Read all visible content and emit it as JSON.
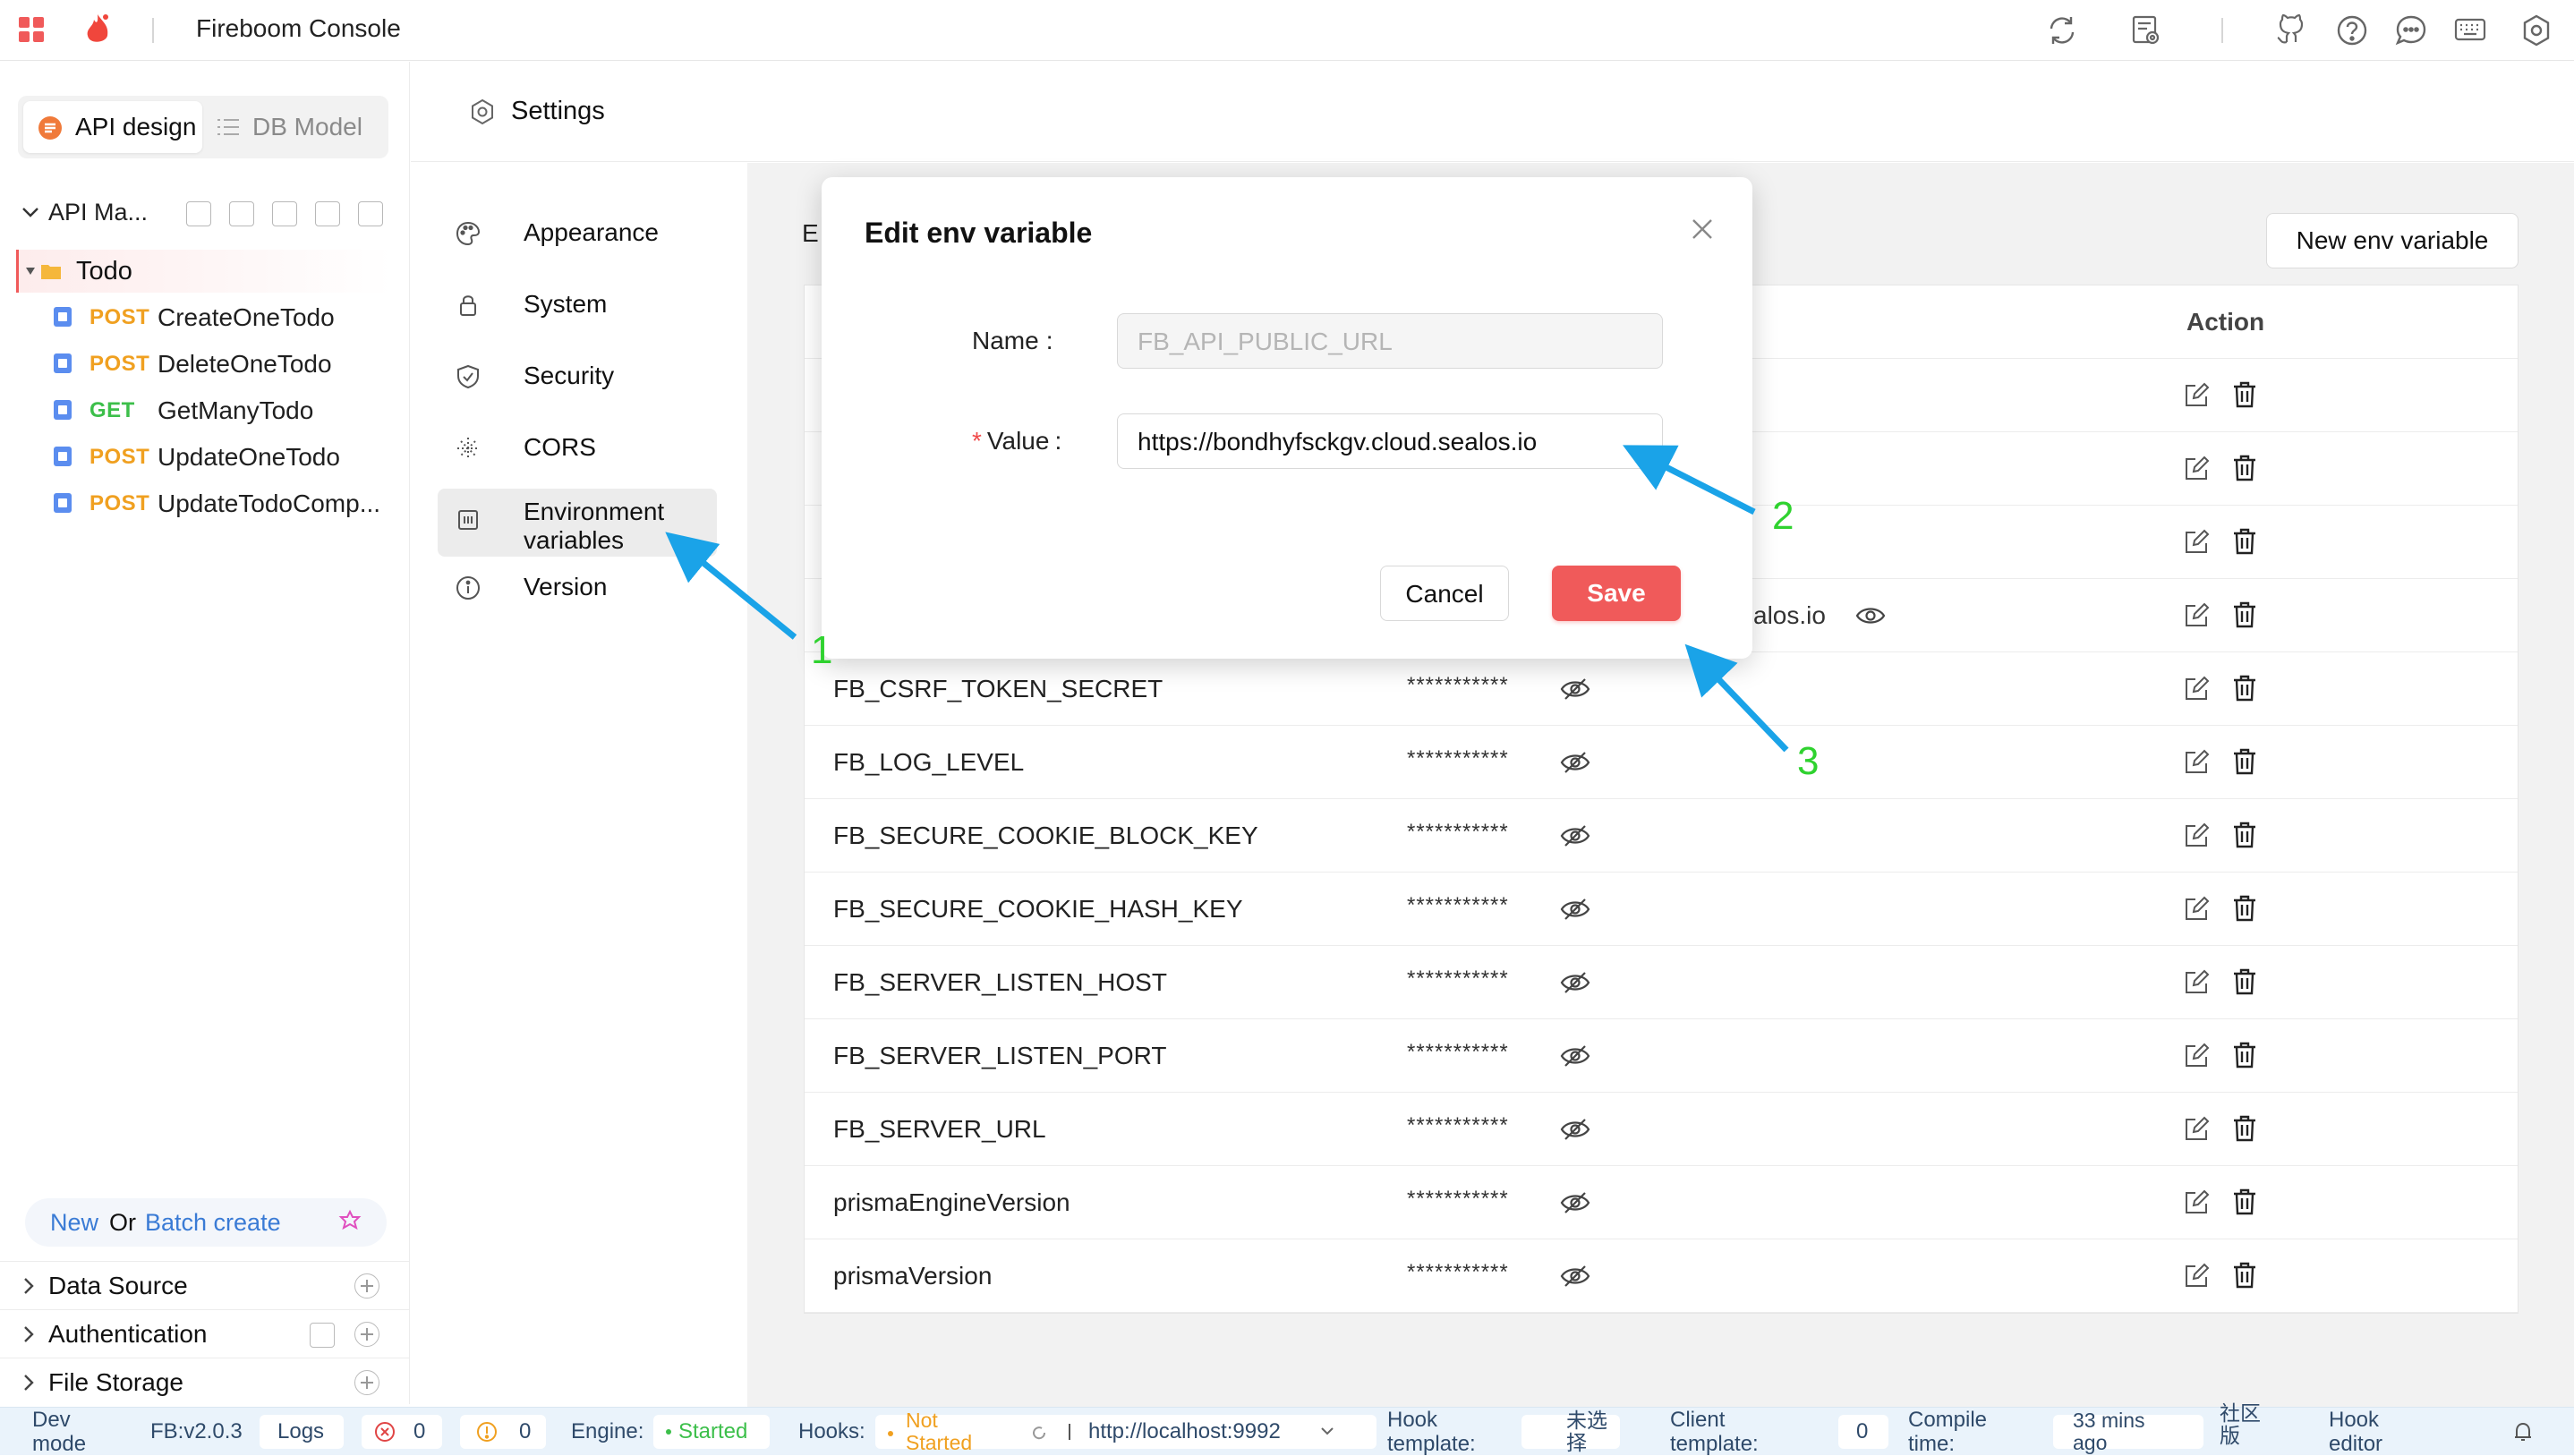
{
  "app": {
    "title": "Fireboom Console"
  },
  "left": {
    "seg_api": "API design",
    "seg_db": "DB Model",
    "api_header": "API Ma...",
    "folder": "Todo",
    "ops": [
      {
        "method": "POST",
        "name": "CreateOneTodo"
      },
      {
        "method": "POST",
        "name": "DeleteOneTodo"
      },
      {
        "method": "GET",
        "name": "GetManyTodo"
      },
      {
        "method": "POST",
        "name": "UpdateOneTodo"
      },
      {
        "method": "POST",
        "name": "UpdateTodoComp..."
      }
    ],
    "new_link": "New",
    "or_text": "Or",
    "batch_link": "Batch create",
    "sections": [
      "Data Source",
      "Authentication",
      "File Storage"
    ]
  },
  "settings": {
    "title": "Settings",
    "nav": [
      "Appearance",
      "System",
      "Security",
      "CORS",
      "Environment variables",
      "Version"
    ]
  },
  "main": {
    "header_partial": "E",
    "new_env_button": "New env variable",
    "action_header": "Action",
    "partial_value": "alos.io",
    "mask": "***********",
    "rows": [
      "FB_CSRF_TOKEN_SECRET",
      "FB_LOG_LEVEL",
      "FB_SECURE_COOKIE_BLOCK_KEY",
      "FB_SECURE_COOKIE_HASH_KEY",
      "FB_SERVER_LISTEN_HOST",
      "FB_SERVER_LISTEN_PORT",
      "FB_SERVER_URL",
      "prismaEngineVersion",
      "prismaVersion"
    ]
  },
  "modal": {
    "title": "Edit env variable",
    "name_label": "Name",
    "name_value": "FB_API_PUBLIC_URL",
    "value_label": "Value",
    "required_mark": "*",
    "label_colon": ":",
    "value_value": "https://bondhyfsckgv.cloud.sealos.io",
    "cancel": "Cancel",
    "save": "Save"
  },
  "callouts": [
    "1",
    "2",
    "3"
  ],
  "status": {
    "dev_mode": "Dev mode",
    "version": "FB:v2.0.3",
    "logs": "Logs",
    "errors": "0",
    "warnings": "0",
    "engine_label": "Engine:",
    "engine_state": "Started",
    "hooks_label": "Hooks:",
    "hooks_state": "Not Started",
    "hooks_url": "http://localhost:9992",
    "hook_template_label": "Hook template:",
    "hook_template_value": "未选择",
    "client_template_label": "Client template:",
    "client_template_value": "0",
    "compile_label": "Compile time:",
    "compile_value": "33 mins ago",
    "community": "社区版",
    "hook_editor": "Hook editor"
  },
  "colors": {
    "accent_red": "#f05a5a",
    "post": "#f0a020",
    "get": "#3cbf4a",
    "link": "#3a7bd5",
    "arrow": "#1aa3e8",
    "callout": "#2fd22f"
  }
}
